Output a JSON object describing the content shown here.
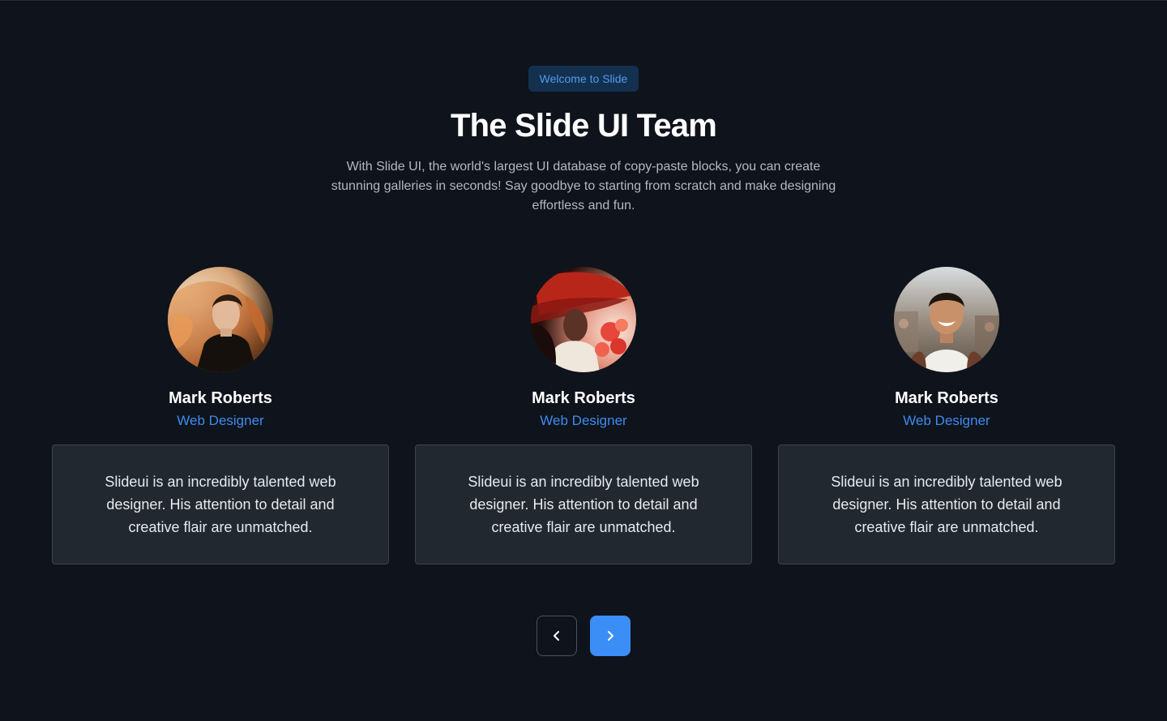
{
  "header": {
    "badge": "Welcome to Slide",
    "title": "The Slide UI Team",
    "subtitle": "With Slide UI, the world's largest UI database of copy-paste blocks, you can create stunning galleries in seconds! Say goodbye to starting from scratch and make designing effortless and fun."
  },
  "team": [
    {
      "name": "Mark Roberts",
      "role": "Web Designer",
      "bio": "Slideui is an incredibly talented web designer. His attention to detail and creative flair are unmatched.",
      "avatar_icon": "portrait-woman-flowing-hair"
    },
    {
      "name": "Mark Roberts",
      "role": "Web Designer",
      "bio": "Slideui is an incredibly talented web designer. His attention to detail and creative flair are unmatched.",
      "avatar_icon": "portrait-woman-red-hat"
    },
    {
      "name": "Mark Roberts",
      "role": "Web Designer",
      "bio": "Slideui is an incredibly talented web designer. His attention to detail and creative flair are unmatched.",
      "avatar_icon": "portrait-smiling-man"
    }
  ],
  "navigation": {
    "prev_icon": "chevron-left-icon",
    "next_icon": "chevron-right-icon"
  },
  "colors": {
    "background": "#0f131b",
    "accent": "#3b8ef5",
    "badge_bg": "#14304f",
    "card_bg": "#212830"
  }
}
